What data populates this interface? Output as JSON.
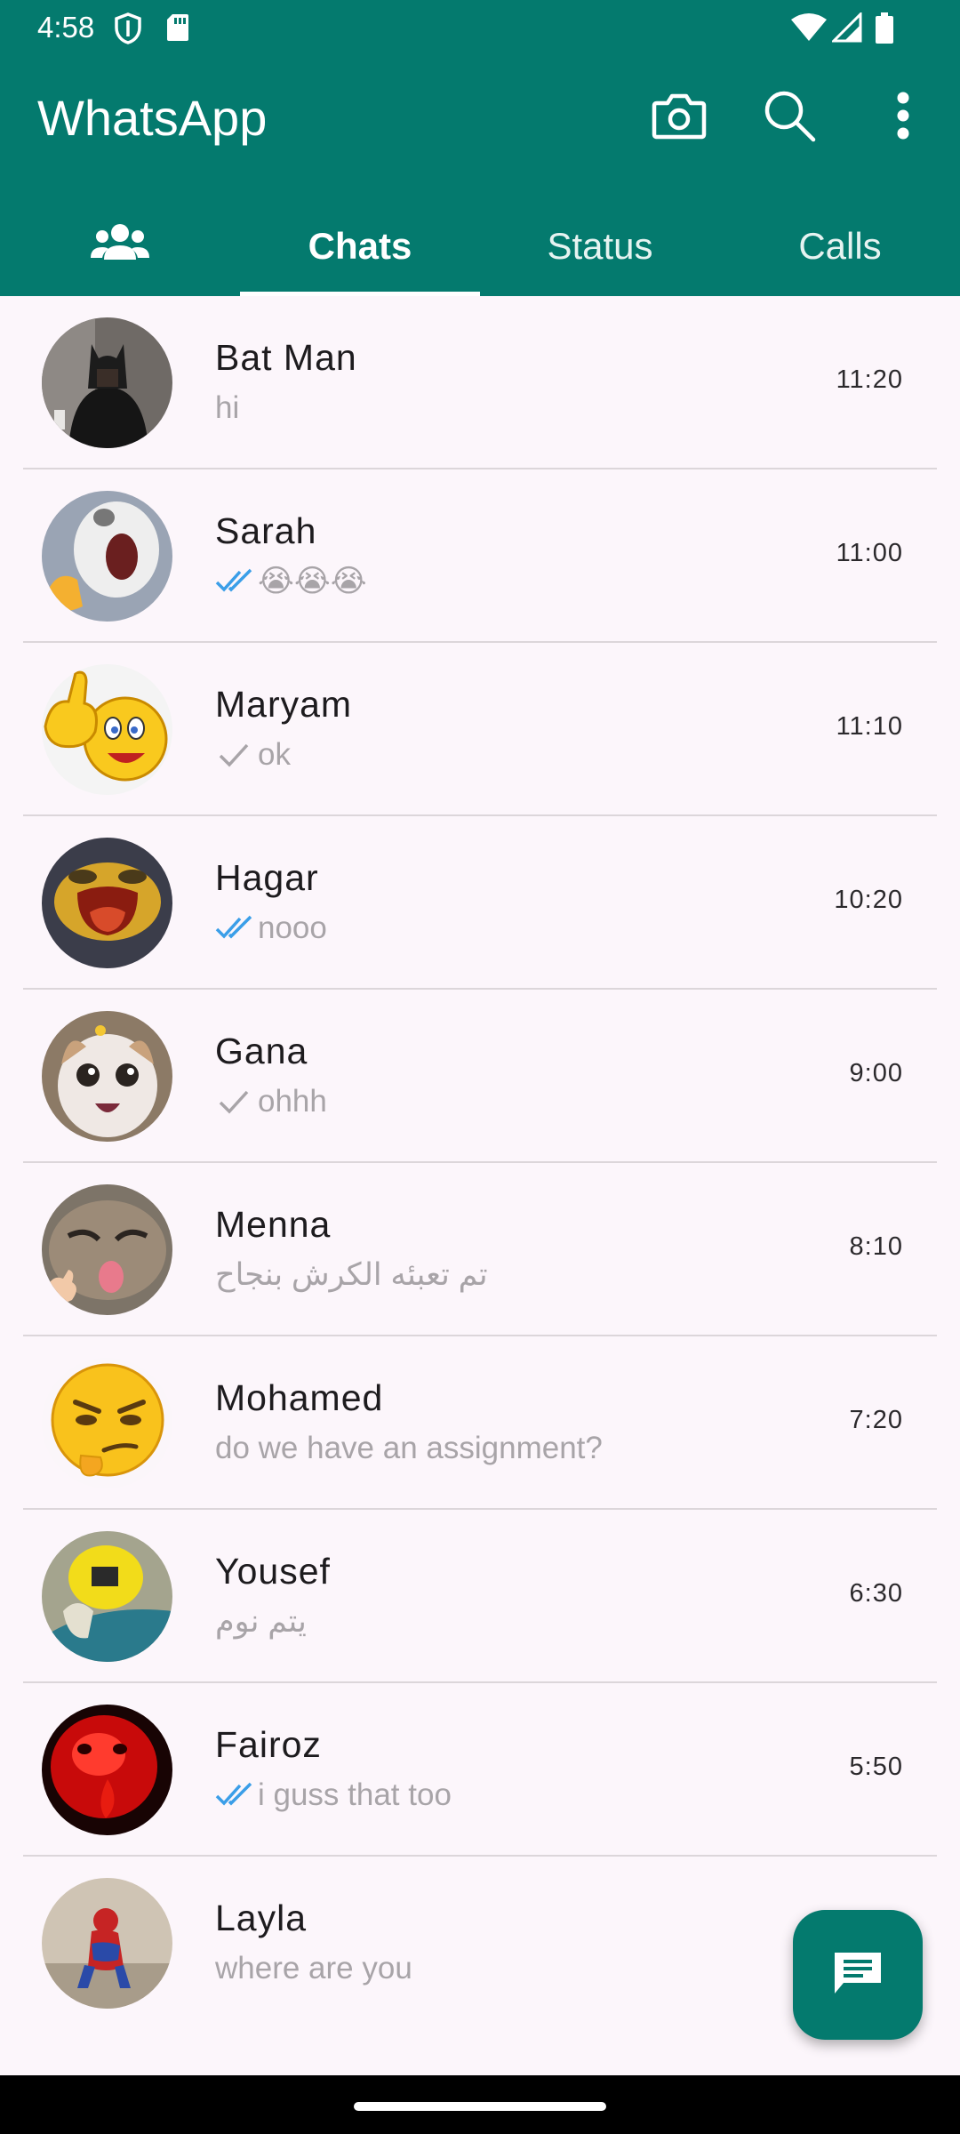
{
  "status_bar": {
    "time": "4:58",
    "icons": [
      "shield-icon",
      "sd-card-icon",
      "wifi-icon",
      "signal-icon",
      "battery-icon"
    ]
  },
  "app_bar": {
    "title": "WhatsApp",
    "actions": [
      "camera-icon",
      "search-icon",
      "more-vert-icon"
    ]
  },
  "tabs": [
    {
      "label": "",
      "icon": "community-icon",
      "active": false
    },
    {
      "label": "Chats",
      "active": true
    },
    {
      "label": "Status",
      "active": false
    },
    {
      "label": "Calls",
      "active": false
    }
  ],
  "chats": [
    {
      "name": "Bat Man",
      "message": "hi",
      "time": "11:20",
      "tick": "none",
      "avatar": "batman-photo"
    },
    {
      "name": "Sarah",
      "message": "😭😭😭",
      "time": "11:00",
      "tick": "double-blue",
      "avatar": "screaming-cat"
    },
    {
      "name": "Maryam",
      "message": "ok",
      "time": "11:10",
      "tick": "single-grey",
      "avatar": "thumbs-up-emoji"
    },
    {
      "name": "Hagar",
      "message": "nooo",
      "time": "10:20",
      "tick": "double-blue",
      "avatar": "yelling-face"
    },
    {
      "name": "Gana",
      "message": "ohhh",
      "time": "9:00",
      "tick": "single-grey",
      "avatar": "surprised-cat"
    },
    {
      "name": "Menna",
      "message": "تم تعبئه الكرش بنجاح",
      "time": "8:10",
      "tick": "none",
      "avatar": "tongue-cat"
    },
    {
      "name": "Mohamed",
      "message": "do we have an assignment?",
      "time": "7:20",
      "tick": "none",
      "avatar": "smirk-emoji"
    },
    {
      "name": "Yousef",
      "message": "يتم نوم",
      "time": "6:30",
      "tick": "none",
      "avatar": "sleeping-blanket"
    },
    {
      "name": "Fairoz",
      "message": "i guss that too",
      "time": "5:50",
      "tick": "double-blue",
      "avatar": "red-face"
    },
    {
      "name": "Layla",
      "message": "where are you",
      "time": "",
      "tick": "none",
      "avatar": "spiderman-sitting"
    }
  ],
  "fab": {
    "icon": "new-chat-icon"
  },
  "colors": {
    "primary": "#047a6e",
    "background": "#fcf6fb",
    "read_tick": "#3a9ee8",
    "subtitle": "#a8a4a8"
  }
}
